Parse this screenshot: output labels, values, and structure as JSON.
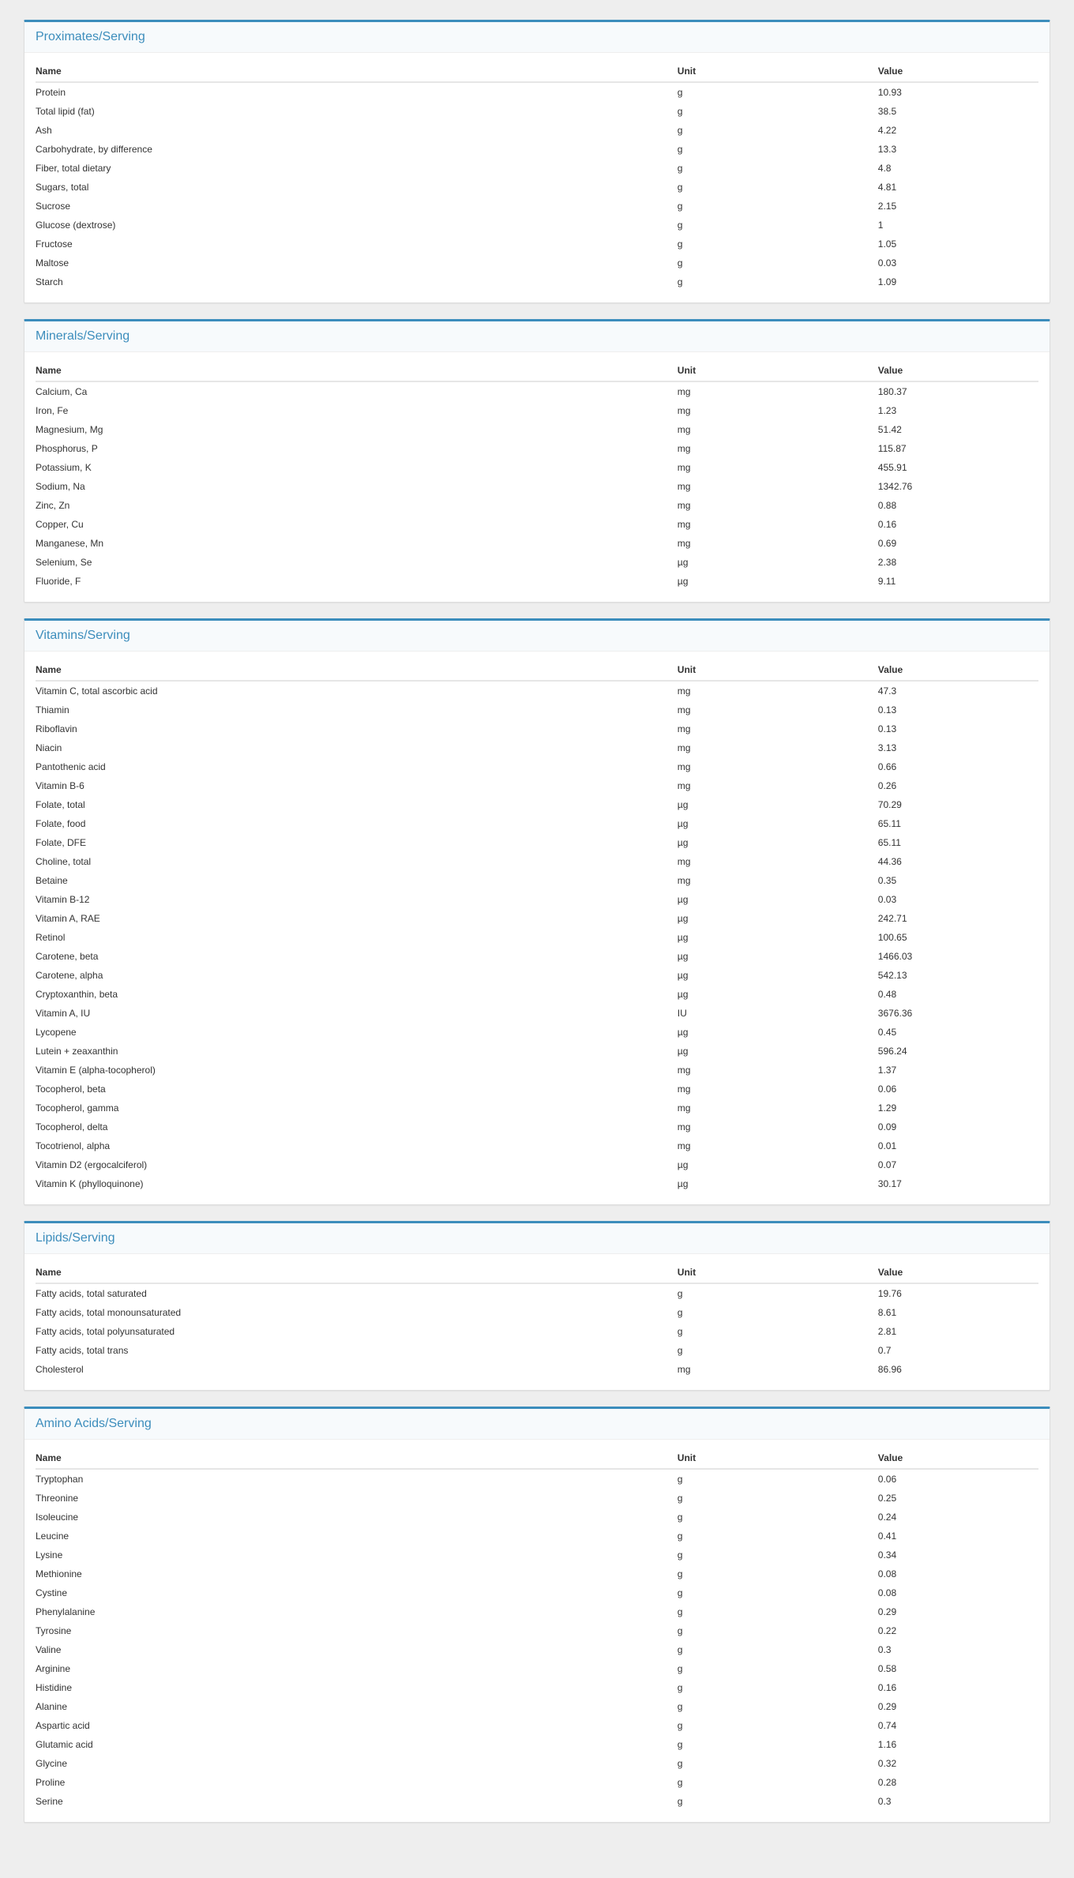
{
  "columns": {
    "name": "Name",
    "unit": "Unit",
    "value": "Value"
  },
  "sections": [
    {
      "title": "Proximates/Serving",
      "rows": [
        {
          "name": "Protein",
          "unit": "g",
          "value": "10.93"
        },
        {
          "name": "Total lipid (fat)",
          "unit": "g",
          "value": "38.5"
        },
        {
          "name": "Ash",
          "unit": "g",
          "value": "4.22"
        },
        {
          "name": "Carbohydrate, by difference",
          "unit": "g",
          "value": "13.3"
        },
        {
          "name": "Fiber, total dietary",
          "unit": "g",
          "value": "4.8"
        },
        {
          "name": "Sugars, total",
          "unit": "g",
          "value": "4.81"
        },
        {
          "name": "Sucrose",
          "unit": "g",
          "value": "2.15"
        },
        {
          "name": "Glucose (dextrose)",
          "unit": "g",
          "value": "1"
        },
        {
          "name": "Fructose",
          "unit": "g",
          "value": "1.05"
        },
        {
          "name": "Maltose",
          "unit": "g",
          "value": "0.03"
        },
        {
          "name": "Starch",
          "unit": "g",
          "value": "1.09"
        }
      ]
    },
    {
      "title": "Minerals/Serving",
      "rows": [
        {
          "name": "Calcium, Ca",
          "unit": "mg",
          "value": "180.37"
        },
        {
          "name": "Iron, Fe",
          "unit": "mg",
          "value": "1.23"
        },
        {
          "name": "Magnesium, Mg",
          "unit": "mg",
          "value": "51.42"
        },
        {
          "name": "Phosphorus, P",
          "unit": "mg",
          "value": "115.87"
        },
        {
          "name": "Potassium, K",
          "unit": "mg",
          "value": "455.91"
        },
        {
          "name": "Sodium, Na",
          "unit": "mg",
          "value": "1342.76"
        },
        {
          "name": "Zinc, Zn",
          "unit": "mg",
          "value": "0.88"
        },
        {
          "name": "Copper, Cu",
          "unit": "mg",
          "value": "0.16"
        },
        {
          "name": "Manganese, Mn",
          "unit": "mg",
          "value": "0.69"
        },
        {
          "name": "Selenium, Se",
          "unit": "µg",
          "value": "2.38"
        },
        {
          "name": "Fluoride, F",
          "unit": "µg",
          "value": "9.11"
        }
      ]
    },
    {
      "title": "Vitamins/Serving",
      "rows": [
        {
          "name": "Vitamin C, total ascorbic acid",
          "unit": "mg",
          "value": "47.3"
        },
        {
          "name": "Thiamin",
          "unit": "mg",
          "value": "0.13"
        },
        {
          "name": "Riboflavin",
          "unit": "mg",
          "value": "0.13"
        },
        {
          "name": "Niacin",
          "unit": "mg",
          "value": "3.13"
        },
        {
          "name": "Pantothenic acid",
          "unit": "mg",
          "value": "0.66"
        },
        {
          "name": "Vitamin B-6",
          "unit": "mg",
          "value": "0.26"
        },
        {
          "name": "Folate, total",
          "unit": "µg",
          "value": "70.29"
        },
        {
          "name": "Folate, food",
          "unit": "µg",
          "value": "65.11"
        },
        {
          "name": "Folate, DFE",
          "unit": "µg",
          "value": "65.11"
        },
        {
          "name": "Choline, total",
          "unit": "mg",
          "value": "44.36"
        },
        {
          "name": "Betaine",
          "unit": "mg",
          "value": "0.35"
        },
        {
          "name": "Vitamin B-12",
          "unit": "µg",
          "value": "0.03"
        },
        {
          "name": "Vitamin A, RAE",
          "unit": "µg",
          "value": "242.71"
        },
        {
          "name": "Retinol",
          "unit": "µg",
          "value": "100.65"
        },
        {
          "name": "Carotene, beta",
          "unit": "µg",
          "value": "1466.03"
        },
        {
          "name": "Carotene, alpha",
          "unit": "µg",
          "value": "542.13"
        },
        {
          "name": "Cryptoxanthin, beta",
          "unit": "µg",
          "value": "0.48"
        },
        {
          "name": "Vitamin A, IU",
          "unit": "IU",
          "value": "3676.36"
        },
        {
          "name": "Lycopene",
          "unit": "µg",
          "value": "0.45"
        },
        {
          "name": "Lutein + zeaxanthin",
          "unit": "µg",
          "value": "596.24"
        },
        {
          "name": "Vitamin E (alpha-tocopherol)",
          "unit": "mg",
          "value": "1.37"
        },
        {
          "name": "Tocopherol, beta",
          "unit": "mg",
          "value": "0.06"
        },
        {
          "name": "Tocopherol, gamma",
          "unit": "mg",
          "value": "1.29"
        },
        {
          "name": "Tocopherol, delta",
          "unit": "mg",
          "value": "0.09"
        },
        {
          "name": "Tocotrienol, alpha",
          "unit": "mg",
          "value": "0.01"
        },
        {
          "name": "Vitamin D2 (ergocalciferol)",
          "unit": "µg",
          "value": "0.07"
        },
        {
          "name": "Vitamin K (phylloquinone)",
          "unit": "µg",
          "value": "30.17"
        }
      ]
    },
    {
      "title": "Lipids/Serving",
      "rows": [
        {
          "name": "Fatty acids, total saturated",
          "unit": "g",
          "value": "19.76"
        },
        {
          "name": "Fatty acids, total monounsaturated",
          "unit": "g",
          "value": "8.61"
        },
        {
          "name": "Fatty acids, total polyunsaturated",
          "unit": "g",
          "value": "2.81"
        },
        {
          "name": "Fatty acids, total trans",
          "unit": "g",
          "value": "0.7"
        },
        {
          "name": "Cholesterol",
          "unit": "mg",
          "value": "86.96"
        }
      ]
    },
    {
      "title": "Amino Acids/Serving",
      "rows": [
        {
          "name": "Tryptophan",
          "unit": "g",
          "value": "0.06"
        },
        {
          "name": "Threonine",
          "unit": "g",
          "value": "0.25"
        },
        {
          "name": "Isoleucine",
          "unit": "g",
          "value": "0.24"
        },
        {
          "name": "Leucine",
          "unit": "g",
          "value": "0.41"
        },
        {
          "name": "Lysine",
          "unit": "g",
          "value": "0.34"
        },
        {
          "name": "Methionine",
          "unit": "g",
          "value": "0.08"
        },
        {
          "name": "Cystine",
          "unit": "g",
          "value": "0.08"
        },
        {
          "name": "Phenylalanine",
          "unit": "g",
          "value": "0.29"
        },
        {
          "name": "Tyrosine",
          "unit": "g",
          "value": "0.22"
        },
        {
          "name": "Valine",
          "unit": "g",
          "value": "0.3"
        },
        {
          "name": "Arginine",
          "unit": "g",
          "value": "0.58"
        },
        {
          "name": "Histidine",
          "unit": "g",
          "value": "0.16"
        },
        {
          "name": "Alanine",
          "unit": "g",
          "value": "0.29"
        },
        {
          "name": "Aspartic acid",
          "unit": "g",
          "value": "0.74"
        },
        {
          "name": "Glutamic acid",
          "unit": "g",
          "value": "1.16"
        },
        {
          "name": "Glycine",
          "unit": "g",
          "value": "0.32"
        },
        {
          "name": "Proline",
          "unit": "g",
          "value": "0.28"
        },
        {
          "name": "Serine",
          "unit": "g",
          "value": "0.3"
        }
      ]
    }
  ]
}
